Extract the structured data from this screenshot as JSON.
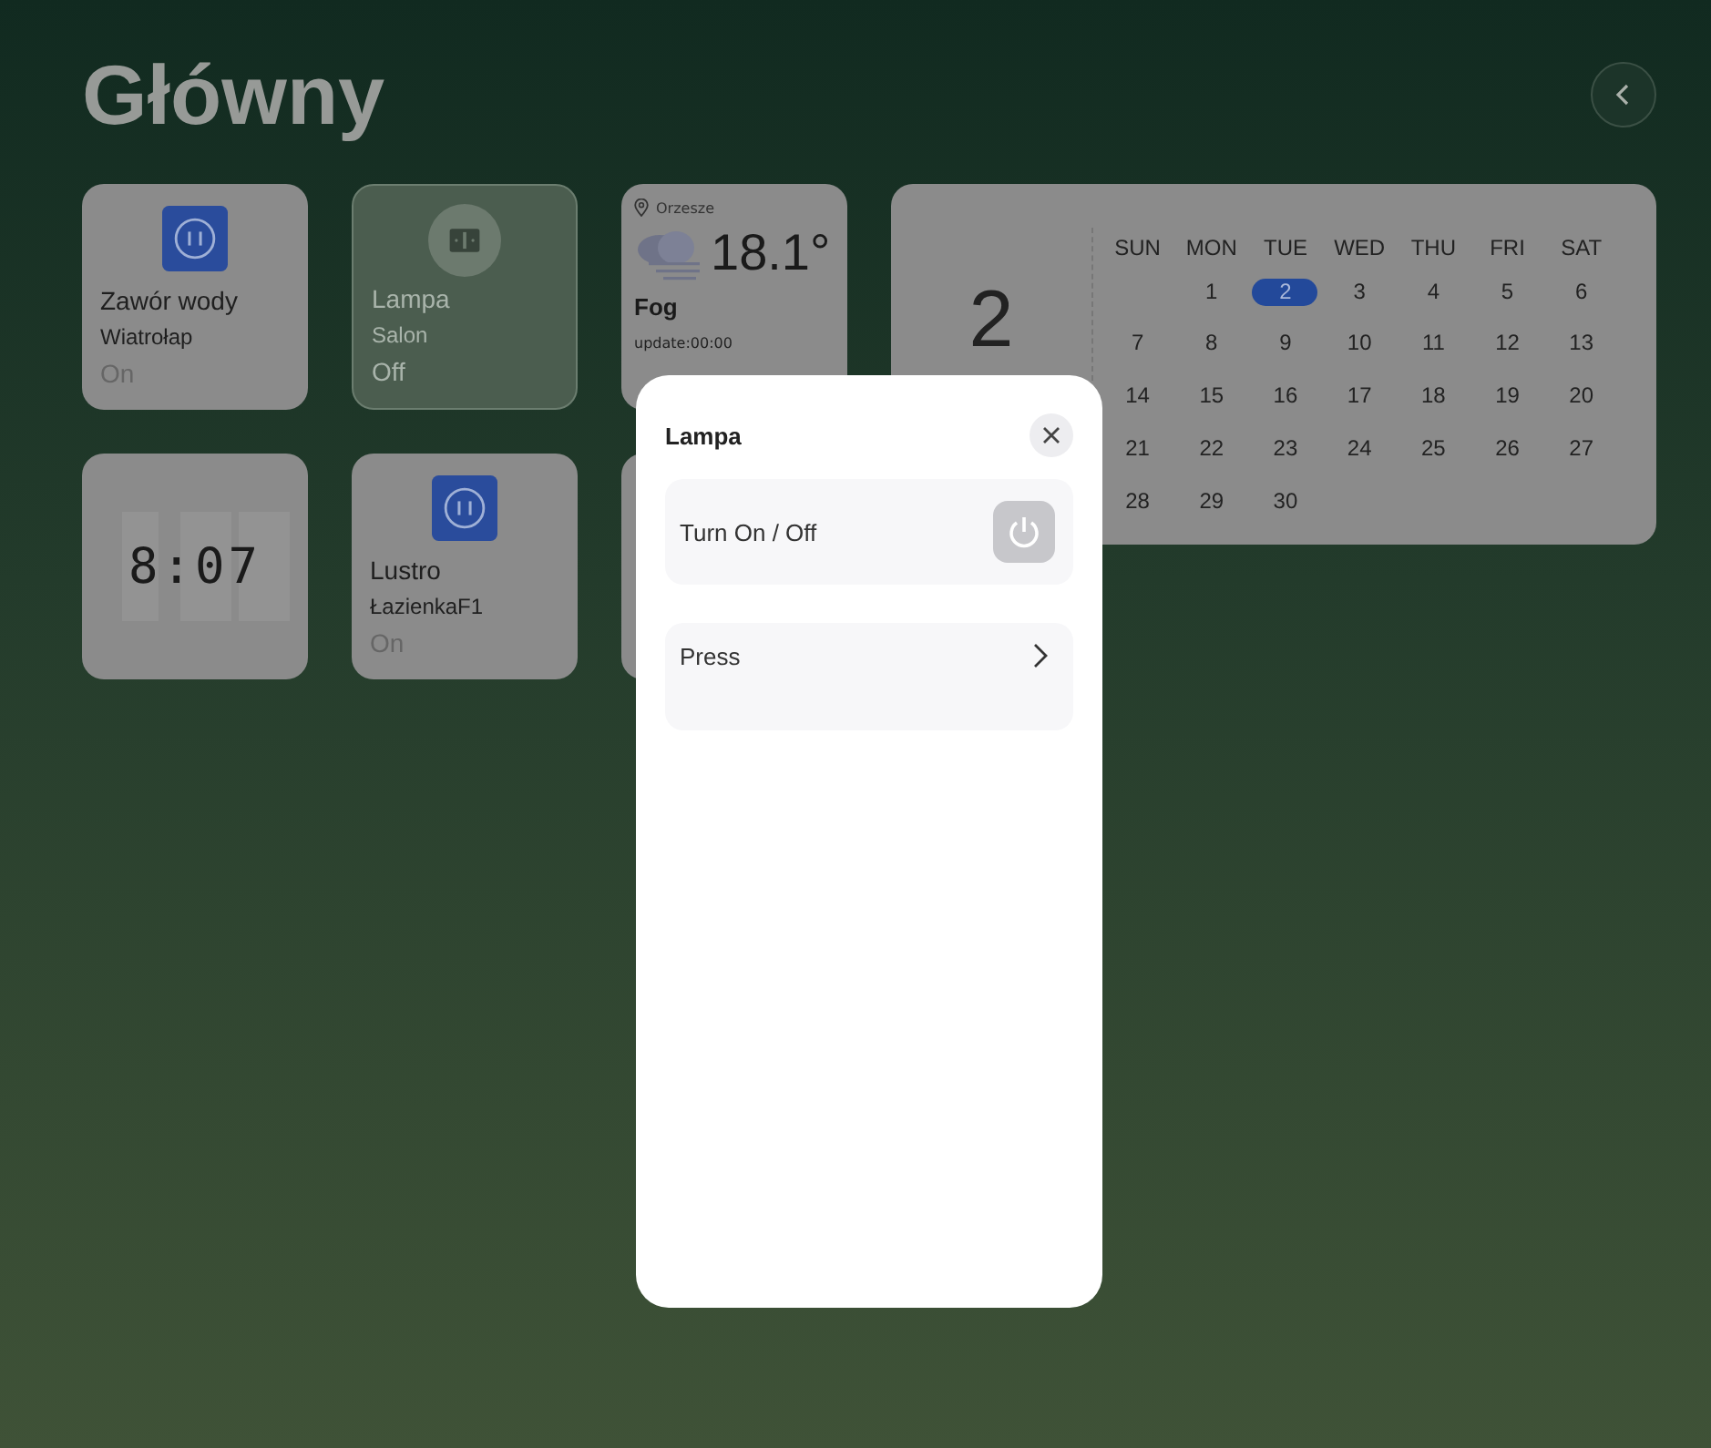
{
  "page": {
    "title": "Główny"
  },
  "tiles": [
    {
      "kind": "socket",
      "name": "Zawór wody",
      "room": "Wiatrołap",
      "status": "On",
      "on": true
    },
    {
      "kind": "switch",
      "name": "Lampa",
      "room": "Salon",
      "status": "Off",
      "on": false
    },
    {
      "kind": "weather",
      "location": "Orzesze",
      "temperature": "18.1°",
      "condition": "Fog",
      "updated": "update:00:00"
    },
    {
      "kind": "clock",
      "time": "8:07"
    },
    {
      "kind": "socket",
      "name": "Lustro",
      "room": "ŁazienkaF1",
      "status": "On",
      "on": true
    },
    {
      "kind": "blank"
    }
  ],
  "calendar": {
    "day": "2",
    "weekdays": [
      "SUN",
      "MON",
      "TUE",
      "WED",
      "THU",
      "FRI",
      "SAT"
    ],
    "weeks": [
      [
        {
          "label": "1",
          "selected": false
        },
        {
          "label": "2",
          "selected": true
        },
        {
          "label": "3",
          "selected": false
        },
        {
          "label": "4",
          "selected": false
        },
        {
          "label": "5",
          "selected": false
        },
        {
          "label": "6",
          "selected": false
        }
      ],
      [
        {
          "label": "7",
          "selected": false
        },
        {
          "label": "8",
          "selected": false
        },
        {
          "label": "9",
          "selected": false
        },
        {
          "label": "10",
          "selected": false
        },
        {
          "label": "11",
          "selected": false
        },
        {
          "label": "12",
          "selected": false
        },
        {
          "label": "13",
          "selected": false
        }
      ],
      [
        {
          "label": "14",
          "selected": false
        },
        {
          "label": "15",
          "selected": false
        },
        {
          "label": "16",
          "selected": false
        },
        {
          "label": "17",
          "selected": false
        },
        {
          "label": "18",
          "selected": false
        },
        {
          "label": "19",
          "selected": false
        },
        {
          "label": "20",
          "selected": false
        }
      ],
      [
        {
          "label": "21",
          "selected": false
        },
        {
          "label": "22",
          "selected": false
        },
        {
          "label": "23",
          "selected": false
        },
        {
          "label": "24",
          "selected": false
        },
        {
          "label": "25",
          "selected": false
        },
        {
          "label": "26",
          "selected": false
        },
        {
          "label": "27",
          "selected": false
        }
      ],
      [
        {
          "label": "28",
          "selected": false
        },
        {
          "label": "29",
          "selected": false
        },
        {
          "label": "30",
          "selected": false
        }
      ]
    ]
  },
  "dialog": {
    "title": "Lampa",
    "rows": [
      {
        "kind": "power",
        "label": "Turn On / Off"
      },
      {
        "kind": "link",
        "label": "Press"
      }
    ]
  }
}
